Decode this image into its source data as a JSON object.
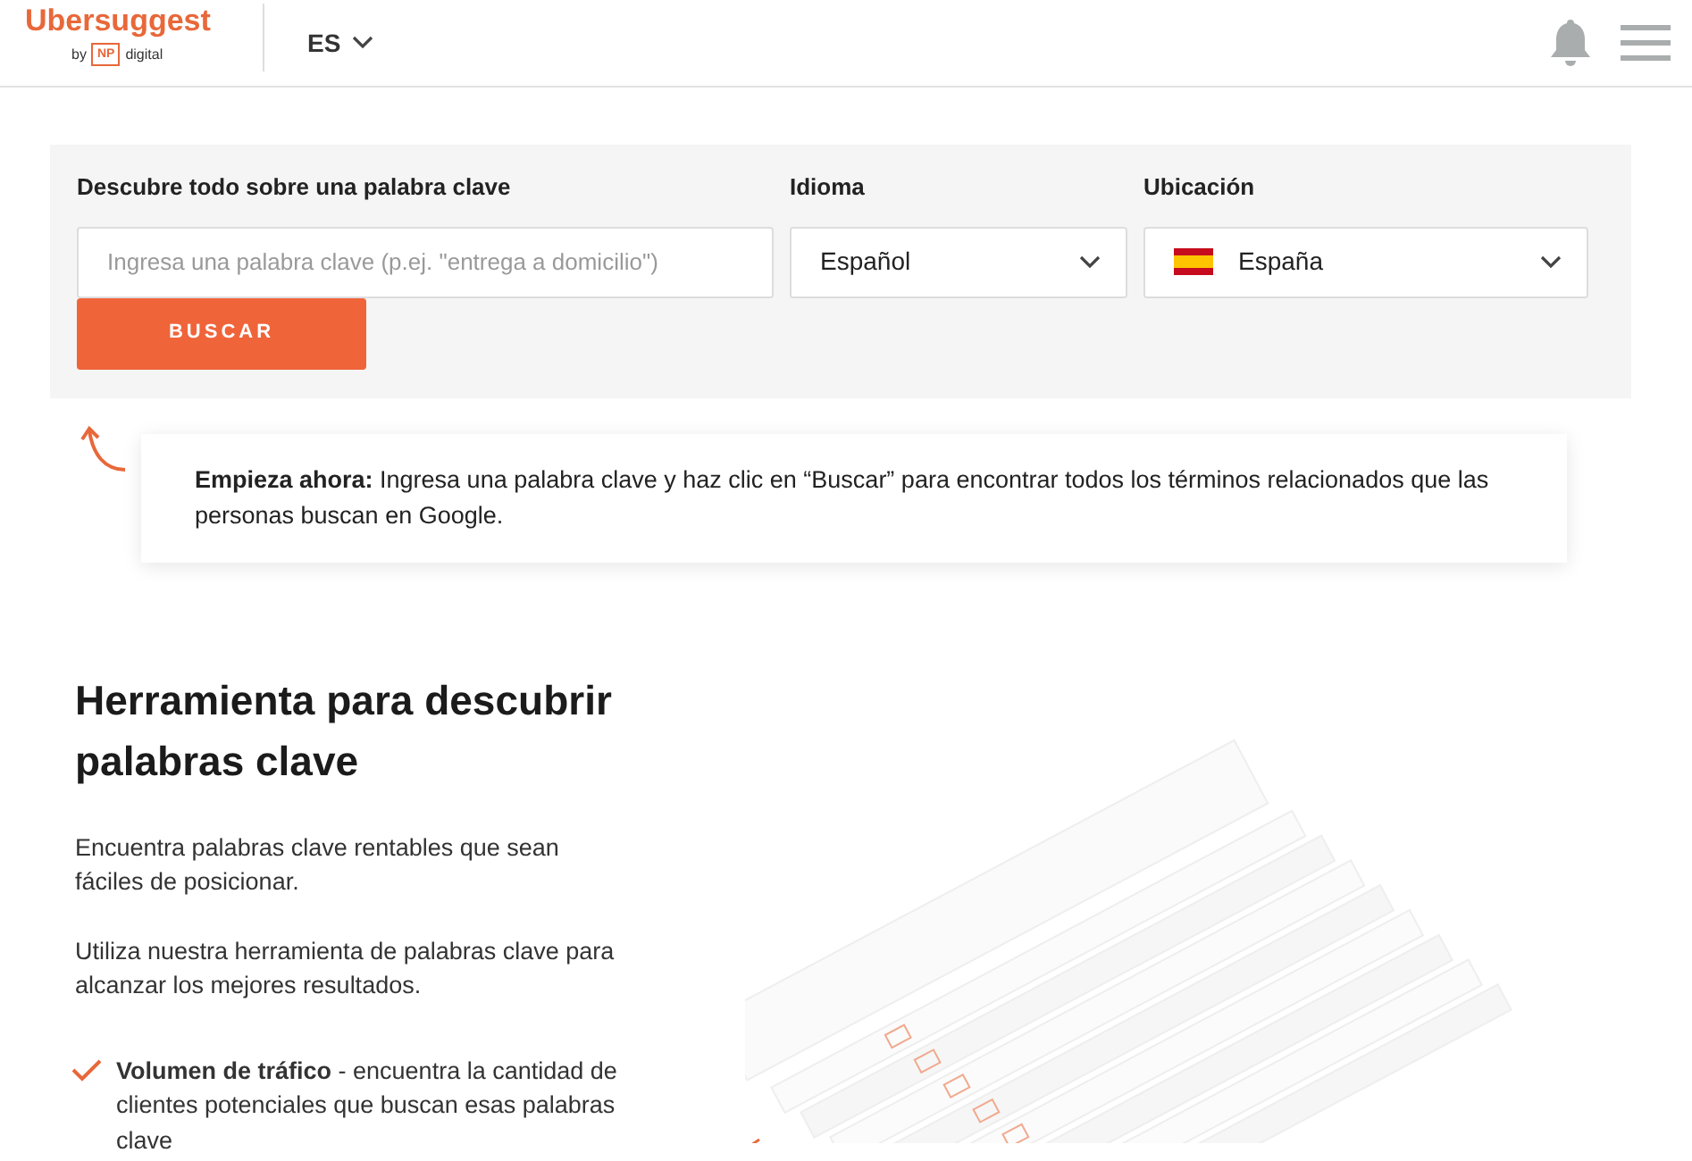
{
  "header": {
    "logo": {
      "name": "Ubersuggest",
      "by": "by",
      "badge": "NP",
      "suffix": "digital"
    },
    "language": "ES"
  },
  "search": {
    "keyword_label": "Descubre todo sobre una palabra clave",
    "placeholder": "Ingresa una palabra clave (p.ej. \"entrega a domicilio\")",
    "button": "BUSCAR",
    "language_field": {
      "label": "Idioma",
      "value": "Español"
    },
    "location_field": {
      "label": "Ubicación",
      "value": "España"
    }
  },
  "tip": {
    "text": "**Empieza ahora:** Ingresa una palabra clave y haz clic en “Buscar” para encontrar todos los términos relacionados que las personas buscan en Google."
  },
  "hero": {
    "title": "Herramienta para descubrir palabras clave",
    "paragraphs": [
      "Encuentra palabras clave rentables que sean fáciles de posicionar.",
      "Utiliza nuestra herramienta de palabras clave para alcanzar los mejores resultados."
    ],
    "features": [
      {
        "text": "**Volumen de tráfico** - encuentra la cantidad de clientes potenciales que buscan esas palabras clave"
      }
    ]
  }
}
